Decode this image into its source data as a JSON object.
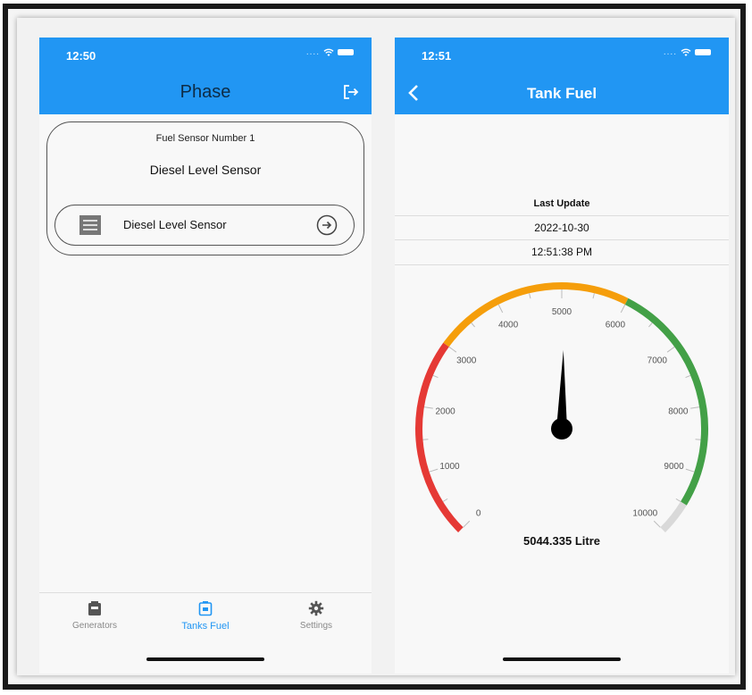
{
  "left_screen": {
    "status_time": "12:50",
    "title": "Phase",
    "sensor_card": {
      "number_label": "Fuel Sensor Number 1",
      "title": "Diesel Level Sensor",
      "row_label": "Diesel Level Sensor"
    },
    "tabs": [
      {
        "label": "Generators",
        "icon": "generator-icon"
      },
      {
        "label": "Tanks Fuel",
        "icon": "tank-icon",
        "active": true
      },
      {
        "label": "Settings",
        "icon": "gear-icon"
      }
    ]
  },
  "right_screen": {
    "status_time": "12:51",
    "title": "Tank Fuel",
    "last_update_label": "Last Update",
    "date": "2022-10-30",
    "time": "12:51:38 PM",
    "gauge": {
      "value": 5044.335,
      "value_text": "5044.335  Litre",
      "min": 0,
      "max": 10000,
      "ticks": [
        "0",
        "1000",
        "2000",
        "3000",
        "4000",
        "5000",
        "6000",
        "7000",
        "8000",
        "9000",
        "10000"
      ],
      "ranges": [
        {
          "from": 0,
          "to": 3000,
          "color": "#e53935"
        },
        {
          "from": 3000,
          "to": 6000,
          "color": "#f59e0b"
        },
        {
          "from": 6000,
          "to": 9500,
          "color": "#43a047"
        },
        {
          "from": 9500,
          "to": 10000,
          "color": "#d9d9d9"
        }
      ]
    }
  },
  "colors": {
    "appbar": "#2196f3",
    "active_tab": "#2196f3"
  }
}
